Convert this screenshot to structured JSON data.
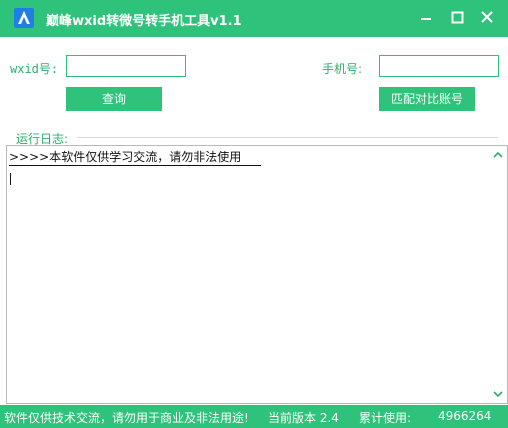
{
  "window": {
    "title": "巅峰wxid转微号转手机工具v1.1",
    "icon": "app-logo-icon",
    "controls": [
      "minimize-icon",
      "maximize-icon",
      "close-icon"
    ]
  },
  "form": {
    "wxid_label": "wxid号:",
    "wxid_value": "",
    "phone_label": "手机号:",
    "phone_value": "",
    "query_button": "查询",
    "match_button": "匹配对比账号"
  },
  "log": {
    "label": "运行日志:",
    "lines": [
      ">>>>本软件仅供学习交流，请勿非法使用"
    ]
  },
  "status": {
    "notice": "软件仅供技术交流，请勿用于商业及非法用途!",
    "version_label": "当前版本 2.4",
    "usage_label": "累计使用:",
    "usage_count": "4966264"
  },
  "colors": {
    "accent": "#2fc27a",
    "label_text": "#2fae6c",
    "icon_blue": "#1f7fe6"
  }
}
